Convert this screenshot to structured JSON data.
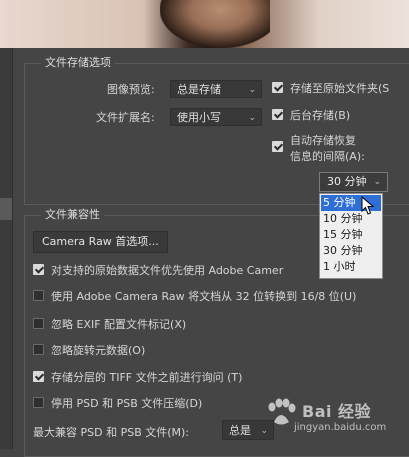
{
  "file_saving": {
    "title": "文件存储选项",
    "image_preview": {
      "label": "图像预览:",
      "value": "总是存储"
    },
    "extension": {
      "label": "文件扩展名:",
      "value": "使用小写"
    },
    "save_as_original": {
      "label": "存储至原始文件夹(S",
      "checked": true
    },
    "background_save": {
      "label": "后台存储(B)",
      "checked": true
    },
    "autosave": {
      "label_line1": "自动存储恢复",
      "label_line2": "信息的间隔(A):",
      "checked": true
    },
    "interval": {
      "value": "30 分钟",
      "options": [
        "5 分钟",
        "10 分钟",
        "15 分钟",
        "30 分钟",
        "1 小时"
      ],
      "highlighted": "5 分钟"
    }
  },
  "compatibility": {
    "title": "文件兼容性",
    "camera_raw_button": "Camera Raw 首选项...",
    "options": [
      {
        "label": "对支持的原始数据文件优先使用 Adobe Camer",
        "checked": true
      },
      {
        "label": "使用 Adobe Camera Raw 将文档从 32 位转换到 16/8 位(U)",
        "checked": false
      },
      {
        "label": "忽略 EXIF 配置文件标记(X)",
        "checked": false
      },
      {
        "label": "忽略旋转元数据(O)",
        "checked": false
      },
      {
        "label": "存储分层的 TIFF 文件之前进行询问 (T)",
        "checked": true
      },
      {
        "label": "停用 PSD 和 PSB 文件压缩(D)",
        "checked": false
      }
    ],
    "max_compat": {
      "label": "最大兼容 PSD 和 PSB 文件(M):",
      "value": "总是"
    }
  },
  "watermark": {
    "brand": "Bai 经验",
    "url": "jingyan.baidu.com"
  },
  "colors": {
    "highlight": "#2e6fd6",
    "panel": "#454545"
  }
}
